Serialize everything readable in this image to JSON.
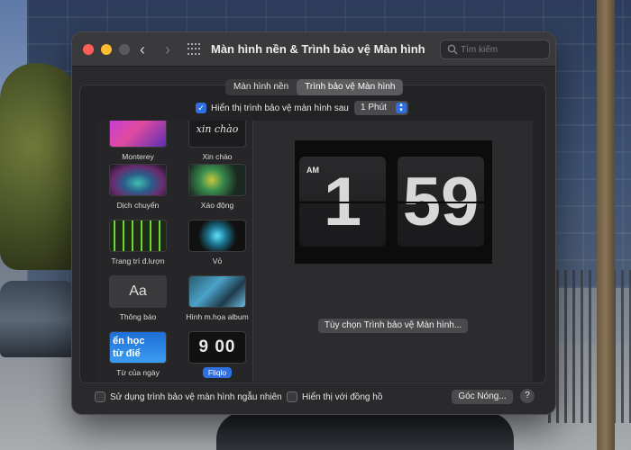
{
  "window": {
    "title": "Màn hình nền & Trình bảo vệ Màn hình",
    "search_placeholder": "Tìm kiếm"
  },
  "tabs": [
    {
      "label": "Màn hình nền",
      "active": false
    },
    {
      "label": "Trình bảo vệ Màn hình",
      "active": true
    }
  ],
  "delay": {
    "label": "Hiển thị trình bảo vệ màn hình sau",
    "checked": true,
    "value": "1 Phút"
  },
  "savers": [
    {
      "label": "Monterey",
      "thumb_text": ""
    },
    {
      "label": "Xin chào",
      "thumb_text": "xin chào"
    },
    {
      "label": "Dịch chuyển",
      "thumb_text": ""
    },
    {
      "label": "Xáo động",
      "thumb_text": ""
    },
    {
      "label": "Trang trí đ.lượn",
      "thumb_text": ""
    },
    {
      "label": "Vỏ",
      "thumb_text": ""
    },
    {
      "label": "Thông báo",
      "thumb_text": "Aa"
    },
    {
      "label": "Hình m.họa album",
      "thumb_text": ""
    },
    {
      "label": "Từ của ngày",
      "thumb_text": "ển học\ntừ điể\nvựng"
    },
    {
      "label": "Fliqlo",
      "thumb_text": "9 00",
      "selected": true
    }
  ],
  "preview": {
    "ampm": "AM",
    "hour": "1",
    "minute": "59"
  },
  "options_button": "Tùy chọn Trình bảo vệ Màn hình...",
  "bottom": {
    "random_label": "Sử dụng trình bảo vệ màn hình ngẫu nhiên",
    "random_checked": false,
    "clock_label": "Hiển thị với đồng hồ",
    "clock_checked": false,
    "hot_corners": "Góc Nóng...",
    "help": "?"
  },
  "colors": {
    "accent": "#2f6fe0",
    "window_bg": "#2a2a2c",
    "close": "#ff5f57",
    "minimize": "#febc2e"
  },
  "icons": [
    "close-icon",
    "minimize-icon",
    "zoom-icon",
    "chevron-left-icon",
    "chevron-right-icon",
    "grid-icon",
    "search-icon",
    "checkmark-icon",
    "chevron-updown-icon",
    "help-icon"
  ]
}
